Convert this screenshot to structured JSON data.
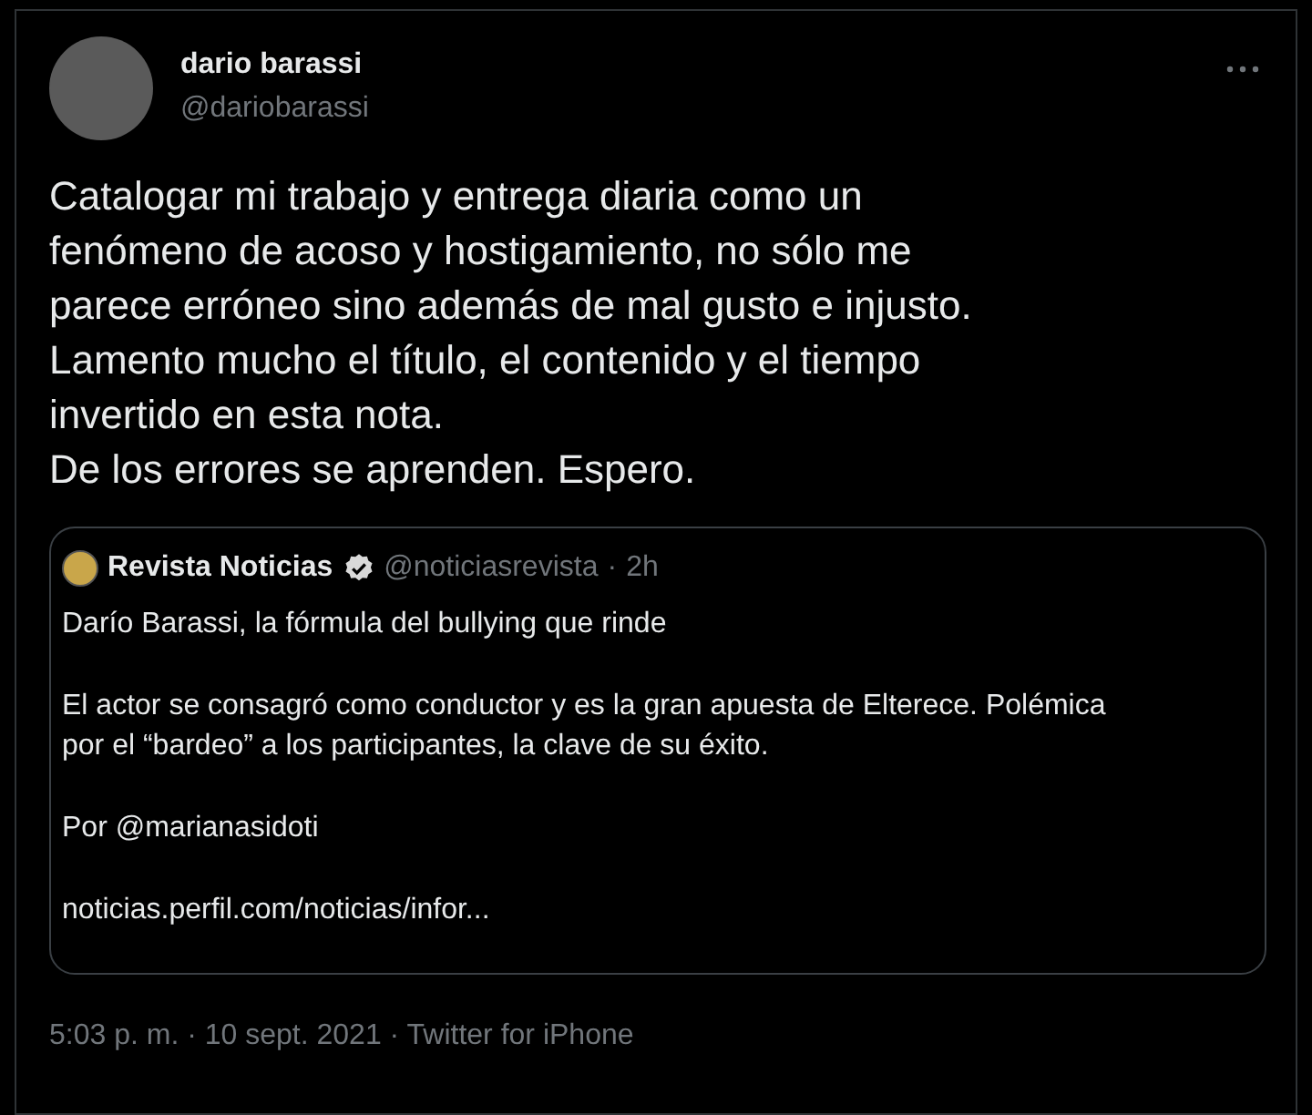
{
  "author": {
    "name": "dario barassi",
    "handle": "@dariobarassi"
  },
  "text_lines": [
    "Catalogar mi trabajo y entrega diaria como un",
    "fenómeno de acoso y hostigamiento, no sólo me",
    "parece erróneo sino además de mal gusto e injusto.",
    "Lamento mucho el título, el contenido y el tiempo",
    "invertido en esta nota.",
    "De los errores se aprenden. Espero."
  ],
  "quoted": {
    "name": "Revista Noticias",
    "verified": true,
    "handle": "@noticiasrevista",
    "separator": "·",
    "time": "2h",
    "paragraphs": [
      [
        "Darío Barassi, la fórmula del bullying que rinde"
      ],
      [
        "El actor se consagró como conductor y es la gran apuesta de Elterece. Polémica",
        "por el “bardeo” a los participantes, la clave de su éxito."
      ],
      [
        "Por @marianasidoti"
      ],
      [
        "noticias.perfil.com/noticias/infor..."
      ]
    ]
  },
  "footer": "5:03 p. m. · 10 sept. 2021 · Twitter for iPhone"
}
